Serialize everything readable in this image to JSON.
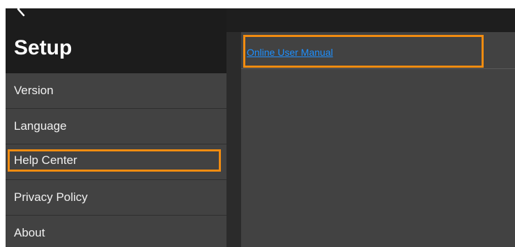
{
  "sidebar": {
    "title": "Setup",
    "items": [
      {
        "label": "Version"
      },
      {
        "label": "Language"
      },
      {
        "label": "Help Center"
      },
      {
        "label": "Privacy Policy"
      },
      {
        "label": "About"
      }
    ]
  },
  "detail": {
    "link_label": "Online User Manual"
  },
  "colors": {
    "highlight": "#f28c10",
    "link": "#1e90ff",
    "panel": "#424242",
    "background": "#1e1e1e"
  },
  "icons": {
    "back": "chevron-left-icon"
  }
}
